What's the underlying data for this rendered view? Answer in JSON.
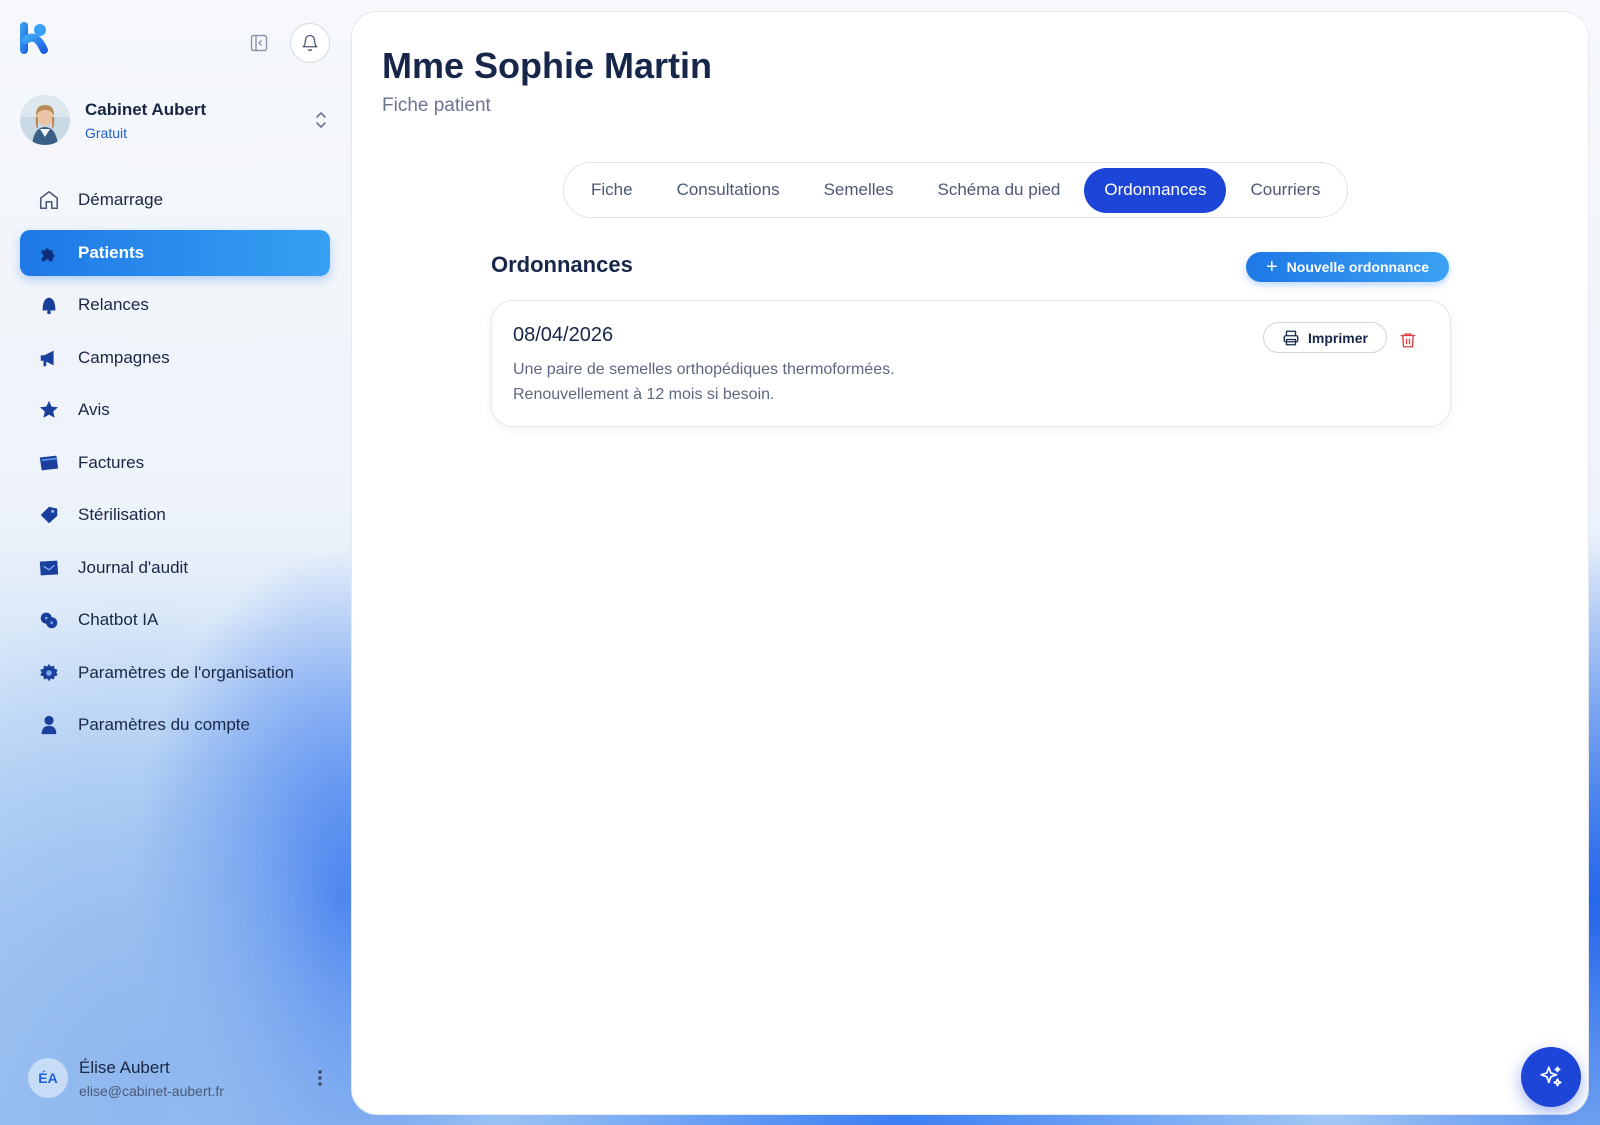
{
  "sidebar": {
    "org": {
      "name": "Cabinet Aubert",
      "plan": "Gratuit"
    },
    "items": [
      {
        "label": "Démarrage",
        "icon": "home-icon",
        "active": false
      },
      {
        "label": "Patients",
        "icon": "puzzle-icon",
        "active": true
      },
      {
        "label": "Relances",
        "icon": "bell-filled-icon",
        "active": false
      },
      {
        "label": "Campagnes",
        "icon": "megaphone-icon",
        "active": false
      },
      {
        "label": "Avis",
        "icon": "star-icon",
        "active": false
      },
      {
        "label": "Factures",
        "icon": "invoice-icon",
        "active": false
      },
      {
        "label": "Stérilisation",
        "icon": "tag-icon",
        "active": false
      },
      {
        "label": "Journal d'audit",
        "icon": "journal-icon",
        "active": false
      },
      {
        "label": "Chatbot IA",
        "icon": "chatbot-icon",
        "active": false
      },
      {
        "label": "Paramètres de l'organisation",
        "icon": "gear-icon",
        "active": false
      },
      {
        "label": "Paramètres du compte",
        "icon": "user-icon",
        "active": false
      }
    ],
    "user": {
      "initials": "ÉA",
      "name": "Élise Aubert",
      "email": "elise@cabinet-aubert.fr"
    }
  },
  "header": {
    "title": "Mme Sophie Martin",
    "subtitle": "Fiche patient"
  },
  "tabs": [
    {
      "label": "Fiche",
      "active": false
    },
    {
      "label": "Consultations",
      "active": false
    },
    {
      "label": "Semelles",
      "active": false
    },
    {
      "label": "Schéma du pied",
      "active": false
    },
    {
      "label": "Ordonnances",
      "active": true
    },
    {
      "label": "Courriers",
      "active": false
    }
  ],
  "section": {
    "title": "Ordonnances",
    "new_button": "Nouvelle ordonnance"
  },
  "prescriptions": [
    {
      "date": "08/04/2026",
      "line1": "Une paire de semelles orthopédiques thermoformées.",
      "line2": "Renouvellement à 12 mois si besoin.",
      "print_label": "Imprimer"
    }
  ],
  "colors": {
    "accent": "#1d46d8",
    "brand": "#1e78e6",
    "danger": "#d93a3a",
    "text": "#16274a"
  }
}
